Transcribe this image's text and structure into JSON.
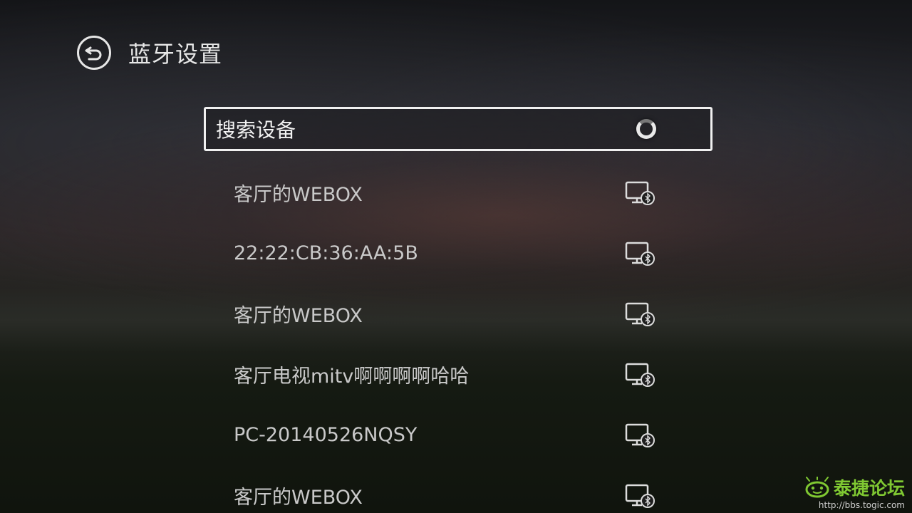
{
  "header": {
    "title": "蓝牙设置",
    "back_icon": "back-icon"
  },
  "search": {
    "label": "搜索设备",
    "status_icon": "loading-spinner-icon"
  },
  "devices": [
    {
      "name": "客厅的WEBOX",
      "icon": "tv-bluetooth-icon"
    },
    {
      "name": "22:22:CB:36:AA:5B",
      "icon": "tv-bluetooth-icon"
    },
    {
      "name": "客厅的WEBOX",
      "icon": "tv-bluetooth-icon"
    },
    {
      "name": "客厅电视mitv啊啊啊啊哈哈",
      "icon": "tv-bluetooth-icon"
    },
    {
      "name": "PC-20140526NQSY",
      "icon": "tv-bluetooth-icon"
    },
    {
      "name": "客厅的WEBOX",
      "icon": "tv-bluetooth-icon"
    }
  ],
  "watermark": {
    "text": "泰捷论坛",
    "url": "http://bbs.togic.com",
    "accent": "#7fc832"
  }
}
